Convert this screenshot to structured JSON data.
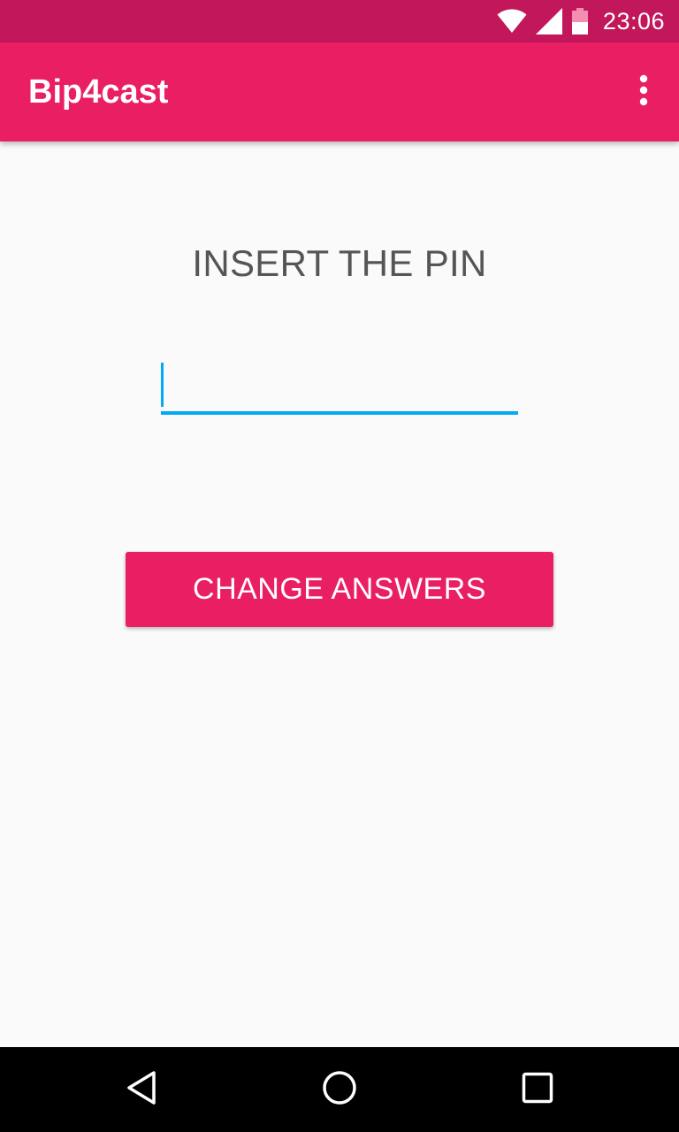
{
  "status_bar": {
    "time": "23:06",
    "icons": [
      "wifi-icon",
      "cell-signal-icon",
      "battery-icon"
    ],
    "color": "#c2185b"
  },
  "app_bar": {
    "title": "Bip4cast",
    "menu_icon": "overflow-menu-icon",
    "color": "#e91e63"
  },
  "main": {
    "pin_label": "INSERT THE PIN",
    "pin_input": {
      "value": "",
      "placeholder": "",
      "accent_color": "#03a9f4"
    },
    "change_button_label": "CHANGE ANSWERS"
  },
  "nav_bar": {
    "buttons": [
      "back-icon",
      "home-icon",
      "recents-icon"
    ]
  }
}
